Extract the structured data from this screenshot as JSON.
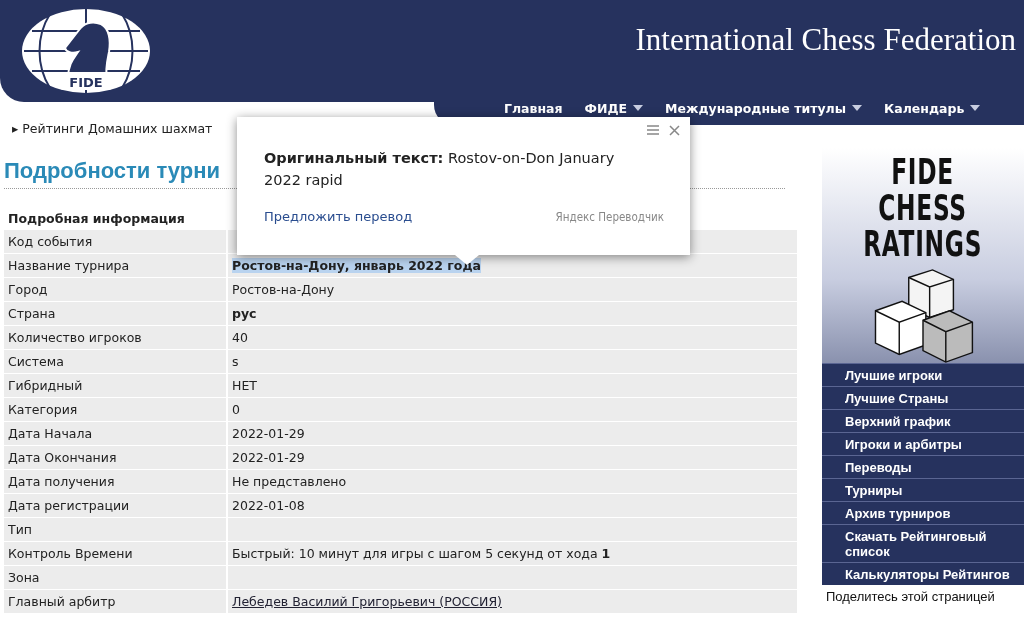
{
  "header": {
    "logo_text": "FIDE",
    "title": "International Chess Federation",
    "nav": [
      {
        "label": "Главная",
        "dropdown": false
      },
      {
        "label": "ФИДЕ",
        "dropdown": true
      },
      {
        "label": "Международные титулы",
        "dropdown": true
      },
      {
        "label": "Календарь",
        "dropdown": true
      }
    ]
  },
  "breadcrumb": {
    "marker": "▸",
    "label": "Рейтинги Домашних шахмат"
  },
  "heading": "Подробности турни",
  "table": {
    "title": "Подробная информация",
    "rows": [
      {
        "label": "Код события",
        "kind": "plain",
        "highlighted": false
      },
      {
        "label": "Название турнира",
        "value": "Ростов-на-Дону, январь 2022 года",
        "kind": "bold",
        "highlighted": true
      },
      {
        "label": "Город",
        "value": "Ростов-на-Дону",
        "kind": "plain",
        "highlighted": false
      },
      {
        "label": "Страна",
        "value": "рус",
        "kind": "bold",
        "highlighted": false
      },
      {
        "label": "Количество игроков",
        "value": "40",
        "kind": "plain",
        "highlighted": false
      },
      {
        "label": "Система",
        "value": "s",
        "kind": "plain",
        "highlighted": false
      },
      {
        "label": "Гибридный",
        "value": "НЕТ",
        "kind": "plain",
        "highlighted": false
      },
      {
        "label": "Категория",
        "value": "0",
        "kind": "plain",
        "highlighted": false
      },
      {
        "label": "Дата Начала",
        "value": "2022-01-29",
        "kind": "plain",
        "highlighted": false
      },
      {
        "label": "Дата Окончания",
        "value": "2022-01-29",
        "kind": "plain",
        "highlighted": false
      },
      {
        "label": "Дата получения",
        "value": "Не представлено",
        "kind": "plain",
        "highlighted": false
      },
      {
        "label": "Дата регистрации",
        "value": "2022-01-08",
        "kind": "plain",
        "highlighted": false
      },
      {
        "label": "Тип",
        "kind": "plain",
        "highlighted": false
      },
      {
        "label": "Контроль Времени",
        "value": "Быстрый: 10 минут для игры с шагом 5 секунд от хода **1**",
        "kind": "plain",
        "highlighted": false
      },
      {
        "label": "Зона",
        "kind": "plain",
        "highlighted": false
      },
      {
        "label": "Главный арбитр",
        "value": "Лебедев Василий Григорьевич (РОССИЯ)",
        "kind": "link",
        "highlighted": false
      }
    ]
  },
  "sidebar": {
    "logo_lines": [
      "FIDE",
      "CHESS",
      "RATINGS"
    ],
    "items": [
      "Лучшие игроки",
      "Лучшие Страны",
      "Верхний график",
      "Игроки и арбитры",
      "Переводы",
      "Турниры",
      "Архив турниров",
      "Скачать Рейтинговый список",
      "Калькуляторы Рейтингов"
    ],
    "share": "Поделитесь этой страницей"
  },
  "popup": {
    "original": "**Оригинальный текст:** Rostov-on-Don January 2022 rapid",
    "suggest": "Предложить перевод",
    "brand": "Яндекс Переводчик"
  }
}
